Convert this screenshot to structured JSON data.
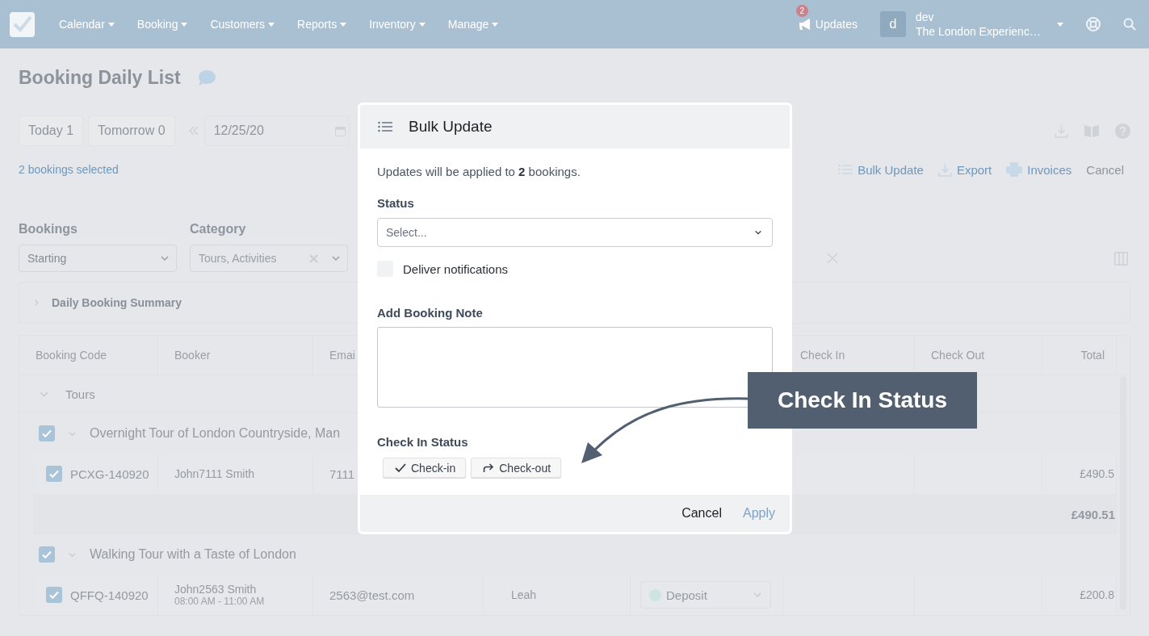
{
  "nav": {
    "menus": [
      "Calendar",
      "Booking",
      "Customers",
      "Reports",
      "Inventory",
      "Manage"
    ],
    "updates": {
      "label": "Updates",
      "badge": "2"
    },
    "user": {
      "avatar": "d",
      "name": "dev",
      "company": "The London Experienc…"
    }
  },
  "page": {
    "title": "Booking Daily List"
  },
  "toolbar": {
    "quick_buttons": [
      "Today 1",
      "Tomorrow 0"
    ],
    "date": "12/25/20"
  },
  "selection": {
    "count_text": "2 bookings selected",
    "actions": [
      {
        "label": "Bulk Update",
        "kind": "list"
      },
      {
        "label": "Export",
        "kind": "download"
      },
      {
        "label": "Invoices",
        "kind": "print"
      },
      {
        "label": "Cancel",
        "kind": "plain"
      }
    ]
  },
  "filters": [
    {
      "label": "Bookings",
      "value": "Starting",
      "clearable": false
    },
    {
      "label": "Category",
      "value": "Tours, Activities",
      "clearable": true
    }
  ],
  "summary": {
    "title": "Daily Booking Summary",
    "expanded": false
  },
  "table": {
    "columns": [
      "Booking Code",
      "Booker",
      "Emai",
      "Check In",
      "Check Out",
      "Total"
    ],
    "groups": [
      {
        "name": "Tours",
        "expanded": true,
        "products": [
          {
            "name": "Overnight Tour of London Countryside, Man",
            "checked": true,
            "expanded": true,
            "subtotal": "£490.51",
            "bookings": [
              {
                "code": "PCXG-140920",
                "checked": true,
                "booker": "John7111 Smith",
                "email": "7111",
                "total": "£490.5"
              }
            ]
          },
          {
            "name": "Walking Tour with a Taste of London",
            "checked": true,
            "expanded": true,
            "bookings": [
              {
                "code": "QFFQ-140920",
                "checked": true,
                "booker": "John2563 Smith",
                "time": "08:00 AM - 11:00 AM",
                "email": "2563@test.com",
                "guide": "Leah",
                "status": {
                  "label": "Deposit",
                  "color": "#cde4df"
                },
                "total": "£200.8"
              }
            ]
          }
        ]
      }
    ]
  },
  "modal": {
    "title": "Bulk Update",
    "intro": "Updates will be applied to **2** bookings.",
    "status": {
      "label": "Status",
      "placeholder": "Select..."
    },
    "notify": {
      "label": "Deliver notifications",
      "checked": false
    },
    "note": {
      "label": "Add Booking Note"
    },
    "checkin": {
      "label": "Check In Status",
      "buttons": [
        {
          "label": "Check-in",
          "kind": "check"
        },
        {
          "label": "Check-out",
          "kind": "forward"
        }
      ]
    },
    "footer": {
      "cancel": "Cancel",
      "apply": {
        "label": "Apply",
        "disabled": true
      }
    }
  },
  "callout": {
    "text": "Check In Status"
  }
}
